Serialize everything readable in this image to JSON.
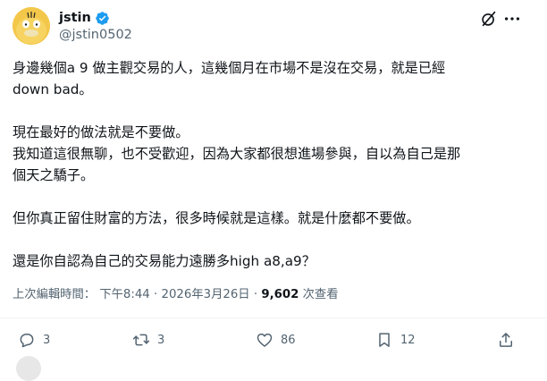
{
  "user": {
    "display_name": "jstin",
    "handle": "@jstin0502",
    "verified": true,
    "avatar_icon": "psyduck-avatar"
  },
  "header_icons": [
    "grok-icon",
    "more-icon"
  ],
  "tweet": {
    "paragraphs": [
      "身邊幾個a 9 做主觀交易的人，這幾個月在市場不是沒在交易，就是已經\ndown bad。",
      "現在最好的做法就是不要做。\n我知道這很無聊，也不受歡迎，因為大家都很想進場參與，自以為自己是那\n個天之驕子。",
      "但你真正留住財富的方法，很多時候就是這樣。就是什麼都不要做。",
      "還是你自認為自己的交易能力遠勝多high a8,a9？"
    ]
  },
  "meta": {
    "edited_label": "上次編輯時間：",
    "time": "下午8:44",
    "separator": "·",
    "date": "2026年3月26日",
    "views_count": "9,602",
    "views_label": "次查看"
  },
  "actions": {
    "reply_count": "3",
    "repost_count": "3",
    "like_count": "86",
    "bookmark_count": "12"
  },
  "colors": {
    "text": "#0f1419",
    "secondary": "#536471",
    "verified_blue": "#1d9bf0",
    "divider": "#eff3f4"
  }
}
